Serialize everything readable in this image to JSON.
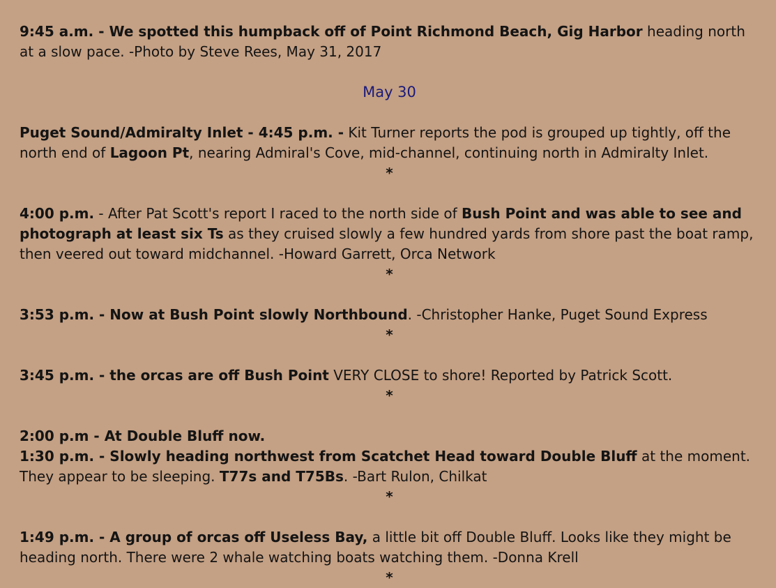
{
  "intro": {
    "b1": "9:45 a.m. - We spotted this humpback off of Point Richmond Beach, Gig Harbor",
    "t1": " heading north at a slow pace.  -Photo by Steve Rees, May 31, 2017"
  },
  "date_heading": "May 30",
  "separator": "*",
  "entries": [
    {
      "b1": "Puget Sound/Admiralty Inlet - 4:45 p.m. -",
      "t1": "   Kit Turner reports the pod is grouped up tightly, off the north end of ",
      "b2": "Lagoon Pt",
      "t2": ", nearing Admiral's Cove, mid-channel, continuing north in Admiralty Inlet."
    },
    {
      "b1": "4:00 p.m.",
      "t1": " - After Pat Scott's report I raced to the north side of ",
      "b2": "Bush Point and was able to see and photograph at least six Ts",
      "t2": " as they cruised slowly a few hundred yards from shore past the boat ramp, then veered out toward midchannel. -Howard Garrett, Orca Network"
    },
    {
      "b1": "3:53 p.m. - Now at Bush Point slowly Northbound",
      "t1": ". -Christopher Hanke, Puget Sound Express"
    },
    {
      "b1": "3:45 p.m. -   the orcas are off Bush Point",
      "t1": " VERY CLOSE to shore! Reported by Patrick Scott."
    },
    {
      "line1": "2:00 p.m - At Double Bluff now.",
      "b1": "1:30 p.m. - Slowly heading northwest from Scatchet Head toward Double Bluff",
      "t1": " at the moment. They appear to be sleeping. ",
      "b2": "T77s and T75Bs",
      "t2": ". -Bart Rulon, Chilkat"
    },
    {
      "b1": "1:49 p.m. - A group of orcas off Useless Bay,",
      "t1": " a little bit off Double Bluff. Looks like they might be heading north. There were 2 whale watching boats watching them. -Donna Krell"
    }
  ]
}
